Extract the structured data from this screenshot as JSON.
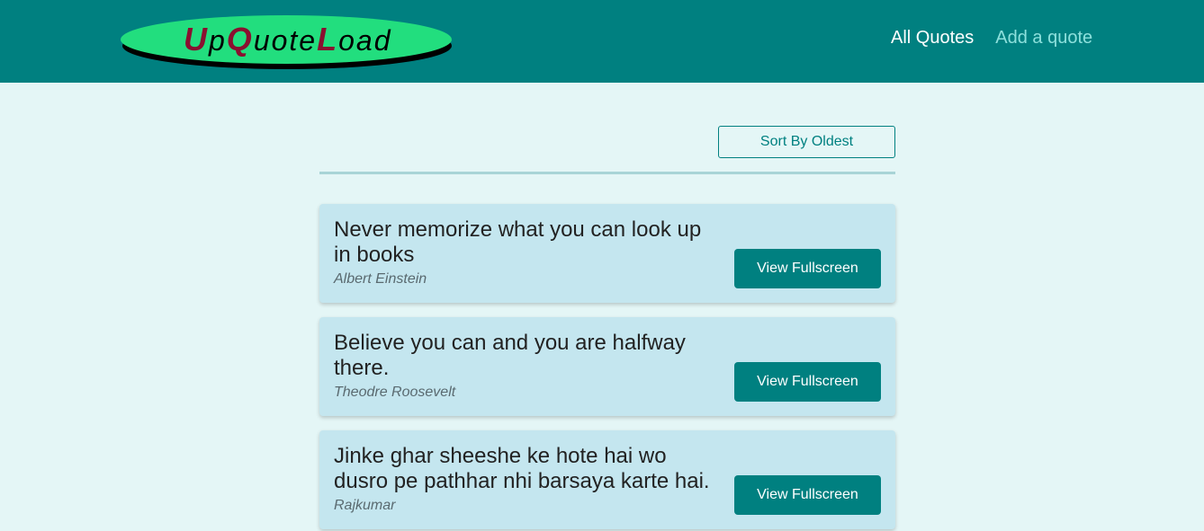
{
  "header": {
    "logo": {
      "parts": [
        {
          "text": "U",
          "big": true
        },
        {
          "text": "p",
          "big": false
        },
        {
          "text": "Q",
          "big": true
        },
        {
          "text": "uote",
          "big": false
        },
        {
          "text": "L",
          "big": true
        },
        {
          "text": "oad",
          "big": false
        }
      ],
      "colors": {
        "oval": "#22de7e",
        "accent_letters": "#8a1030"
      }
    },
    "nav": [
      {
        "label": "All Quotes",
        "active": true
      },
      {
        "label": "Add a quote",
        "active": false
      }
    ],
    "background": "#008080"
  },
  "toolbar": {
    "sort_label": "Sort By Oldest"
  },
  "quotes": [
    {
      "text": "Never memorize what you can look up in books",
      "author": "Albert Einstein",
      "button": "View Fullscreen"
    },
    {
      "text": "Believe you can and you are halfway there.",
      "author": "Theodre Roosevelt",
      "button": "View Fullscreen"
    },
    {
      "text": "Jinke ghar sheeshe ke hote hai wo dusro pe pathhar nhi barsaya karte hai.",
      "author": "Rajkumar",
      "button": "View Fullscreen"
    }
  ],
  "colors": {
    "page_background": "#e4f6f6",
    "card_background": "#c4e6ef",
    "accent": "#008080"
  }
}
